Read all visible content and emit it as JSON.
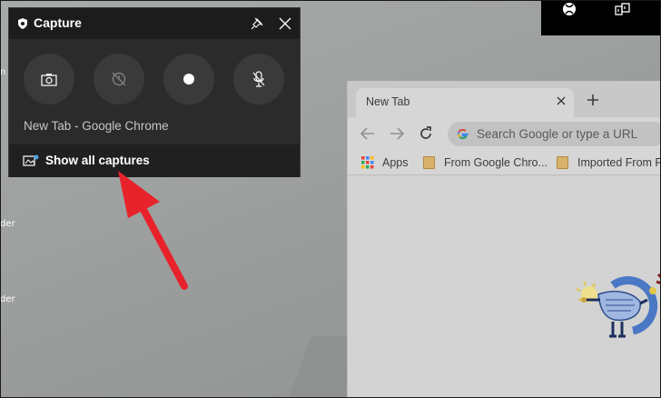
{
  "desktop": {
    "label_1": "n",
    "label_2": "der",
    "label_3": "der"
  },
  "xbox_bar": {
    "icons": [
      "xbox-icon",
      "widget-menu-icon"
    ]
  },
  "capture_widget": {
    "title": "Capture",
    "window_name": "New Tab - Google Chrome",
    "buttons": [
      {
        "name": "screenshot-button",
        "icon": "camera-icon"
      },
      {
        "name": "record-last-30s-button",
        "icon": "rewind-record-icon"
      },
      {
        "name": "start-recording-button",
        "icon": "record-dot-icon"
      },
      {
        "name": "mic-toggle-button",
        "icon": "mic-off-icon"
      }
    ],
    "footer_label": "Show all captures",
    "colors": {
      "panel": "#2b2b2b",
      "header": "#1c1c1c",
      "button": "#3a3a3a"
    }
  },
  "chrome": {
    "tab_title": "New Tab",
    "omnibox_placeholder": "Search Google or type a URL",
    "bookmarks": [
      "Apps",
      "From Google Chro...",
      "Imported From Fi"
    ]
  },
  "annotation": {
    "arrow_color": "#e8222a"
  }
}
